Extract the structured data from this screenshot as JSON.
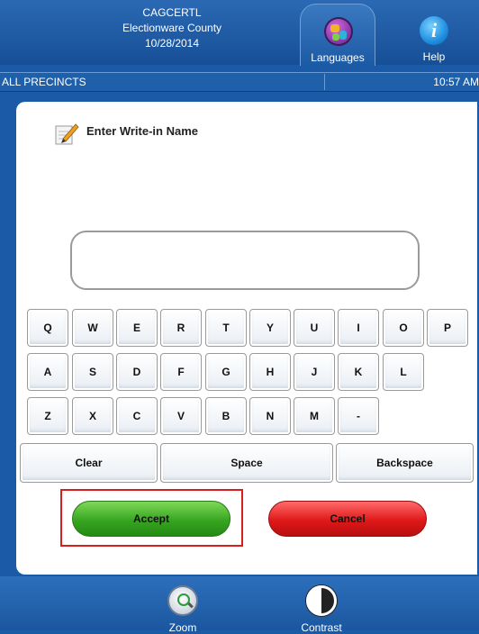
{
  "header": {
    "line1": "CAGCERTL",
    "line2": "Electionware County",
    "line3": "10/28/2014",
    "languages_label": "Languages",
    "help_label": "Help",
    "help_glyph": "i"
  },
  "status": {
    "precincts": "ALL PRECINCTS",
    "time": "10:57 AM"
  },
  "prompt": {
    "instruction": "Enter Write-in Name",
    "input_value": ""
  },
  "keyboard": {
    "row1": [
      "Q",
      "W",
      "E",
      "R",
      "T",
      "Y",
      "U",
      "I",
      "O",
      "P"
    ],
    "row2": [
      "A",
      "S",
      "D",
      "F",
      "G",
      "H",
      "J",
      "K",
      "L"
    ],
    "row3": [
      "Z",
      "X",
      "C",
      "V",
      "B",
      "N",
      "M",
      "-"
    ],
    "clear": "Clear",
    "space": "Space",
    "backspace": "Backspace"
  },
  "actions": {
    "accept": "Accept",
    "cancel": "Cancel",
    "accept_color": "#37a521",
    "cancel_color": "#e01818"
  },
  "footer": {
    "zoom": "Zoom",
    "contrast": "Contrast"
  },
  "icons": {
    "languages": "globe-icon",
    "help": "info-icon",
    "write_in": "pencil-icon",
    "zoom": "magnifier-icon",
    "contrast": "contrast-icon"
  }
}
